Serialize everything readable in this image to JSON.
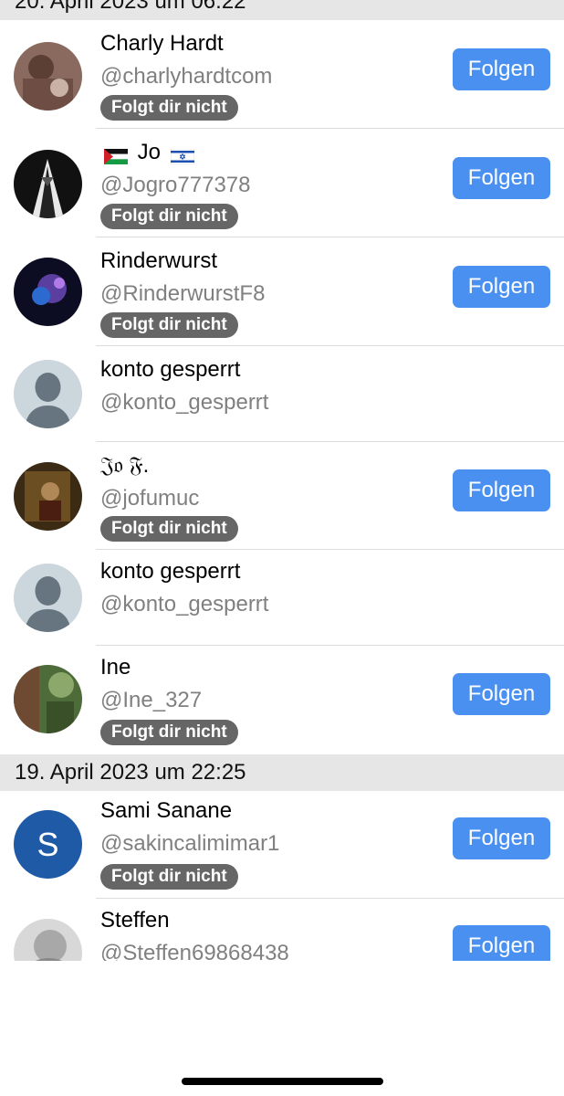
{
  "sections": [
    {
      "header": "20. April 2023 um 06:22"
    },
    {
      "header": "19. April 2023 um 22:25"
    }
  ],
  "rows": [
    {
      "name": "Charly Hardt",
      "handle": "@charlyhardtcom",
      "badge": "Folgt dir nicht",
      "button": "Folgen",
      "avatar": "photo-avatar"
    },
    {
      "name": "Jo",
      "flag_left": "palestine-flag-icon",
      "flag_right": "israel-flag-icon",
      "handle": "@Jogro777378",
      "badge": "Folgt dir nicht",
      "button": "Folgen",
      "avatar": "photo-avatar"
    },
    {
      "name": "Rinderwurst",
      "handle": "@RinderwurstF8",
      "badge": "Folgt dir nicht",
      "button": "Folgen",
      "avatar": "photo-avatar"
    },
    {
      "name": "konto gesperrt",
      "handle": "@konto_gesperrt",
      "avatar": "default-user-icon"
    },
    {
      "name": "𝔍𝔬 𝔉.",
      "handle": "@jofumuc",
      "badge": "Folgt dir nicht",
      "button": "Folgen",
      "avatar": "photo-avatar"
    },
    {
      "name": "konto gesperrt",
      "handle": "@konto_gesperrt",
      "avatar": "default-user-icon"
    },
    {
      "name": "Ine",
      "handle": "@Ine_327",
      "badge": "Folgt dir nicht",
      "button": "Folgen",
      "avatar": "photo-avatar"
    },
    {
      "name": "Sami Sanane",
      "handle": "@sakincalimimar1",
      "badge": "Folgt dir nicht",
      "button": "Folgen",
      "avatar": "letter-avatar",
      "avatar_letter": "S"
    },
    {
      "name": "Steffen",
      "handle": "@Steffen69868438",
      "button": "Folgen",
      "avatar": "photo-avatar"
    }
  ],
  "colors": {
    "button": "#4a90f0",
    "badge": "#666666",
    "header_bg": "#e6e6e6",
    "handle": "#808080"
  }
}
